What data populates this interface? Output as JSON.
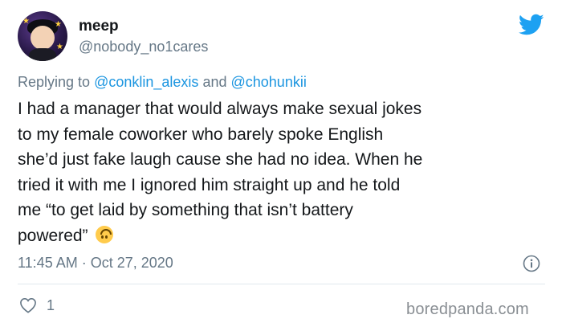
{
  "tweet": {
    "author_name": "meep",
    "author_handle": "@nobody_no1cares",
    "reply_prefix": "Replying to",
    "reply_mention_1": "@conklin_alexis",
    "reply_joiner": "and",
    "reply_mention_2": "@chohunkii",
    "body_lines": [
      "I had a manager that would always make sexual jokes",
      "to my female coworker who barely spoke English",
      "she’d just fake laugh cause she had no idea. When he",
      "tried it with me I ignored him straight up and he told",
      "me “to get laid by something that isn’t battery",
      "powered”"
    ],
    "emoji": "upside-down-face",
    "timestamp": "11:45 AM · Oct 27, 2020",
    "like_count": "1"
  },
  "watermark": "boredpanda.com",
  "colors": {
    "twitter_blue": "#1da1f2",
    "mention_blue": "#1b95e0",
    "secondary_text": "#657786",
    "primary_text": "#14171a"
  },
  "icons": {
    "brand": "twitter-bird-icon",
    "info": "info-icon",
    "like": "heart-icon"
  }
}
